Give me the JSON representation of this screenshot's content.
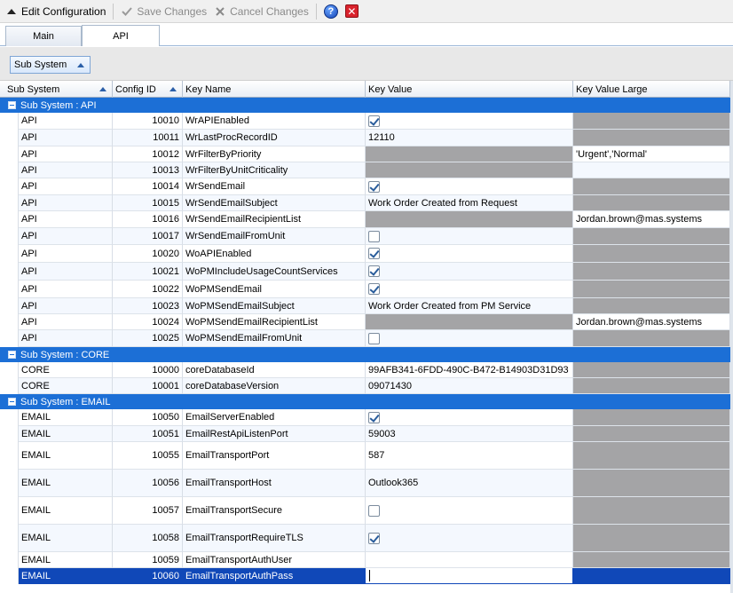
{
  "toolbar": {
    "edit_label": "Edit Configuration",
    "save_label": "Save Changes",
    "cancel_label": "Cancel Changes",
    "help_symbol": "?",
    "close_symbol": "✕"
  },
  "tabs": [
    {
      "label": "Main",
      "active": false
    },
    {
      "label": "API",
      "active": true
    }
  ],
  "group_panel": {
    "chip_label": "Sub System"
  },
  "columns": {
    "sub_system": "Sub System",
    "config_id": "Config ID",
    "key_name": "Key Name",
    "key_value": "Key Value",
    "key_value_large": "Key Value Large"
  },
  "groups": [
    {
      "label": "Sub System : API",
      "rows": [
        {
          "sub": "API",
          "id": "10010",
          "name": "WrAPIEnabled",
          "value_type": "checkbox",
          "checked": true,
          "value": "",
          "large": "",
          "large_gray": true
        },
        {
          "sub": "API",
          "id": "10011",
          "name": "WrLastProcRecordID",
          "value_type": "text",
          "value": "12110",
          "large": "",
          "large_gray": true
        },
        {
          "sub": "API",
          "id": "10012",
          "name": "WrFilterByPriority",
          "value_type": "gray",
          "value": "",
          "large": "'Urgent','Normal'",
          "large_gray": false
        },
        {
          "sub": "API",
          "id": "10013",
          "name": "WrFilterByUnitCriticality",
          "value_type": "gray",
          "value": "",
          "large": "",
          "large_gray": false
        },
        {
          "sub": "API",
          "id": "10014",
          "name": "WrSendEmail",
          "value_type": "checkbox",
          "checked": true,
          "value": "",
          "large": "",
          "large_gray": true
        },
        {
          "sub": "API",
          "id": "10015",
          "name": "WrSendEmailSubject",
          "value_type": "text",
          "value": "Work Order Created from Request",
          "large": "",
          "large_gray": true
        },
        {
          "sub": "API",
          "id": "10016",
          "name": "WrSendEmailRecipientList",
          "value_type": "gray",
          "value": "",
          "large": "Jordan.brown@mas.systems",
          "large_gray": false
        },
        {
          "sub": "API",
          "id": "10017",
          "name": "WrSendEmailFromUnit",
          "value_type": "checkbox",
          "checked": false,
          "value": "",
          "large": "",
          "large_gray": true
        },
        {
          "sub": "API",
          "id": "10020",
          "name": "WoAPIEnabled",
          "value_type": "checkbox",
          "checked": true,
          "value": "",
          "large": "",
          "large_gray": true
        },
        {
          "sub": "API",
          "id": "10021",
          "name": "WoPMIncludeUsageCountServices",
          "value_type": "checkbox",
          "checked": true,
          "value": "",
          "large": "",
          "large_gray": true
        },
        {
          "sub": "API",
          "id": "10022",
          "name": "WoPMSendEmail",
          "value_type": "checkbox",
          "checked": true,
          "value": "",
          "large": "",
          "large_gray": true
        },
        {
          "sub": "API",
          "id": "10023",
          "name": "WoPMSendEmailSubject",
          "value_type": "text",
          "value": "Work Order Created from PM Service",
          "large": "",
          "large_gray": true
        },
        {
          "sub": "API",
          "id": "10024",
          "name": "WoPMSendEmailRecipientList",
          "value_type": "gray",
          "value": "",
          "large": "Jordan.brown@mas.systems",
          "large_gray": false
        },
        {
          "sub": "API",
          "id": "10025",
          "name": "WoPMSendEmailFromUnit",
          "value_type": "checkbox",
          "checked": false,
          "value": "",
          "large": "",
          "large_gray": true
        }
      ]
    },
    {
      "label": "Sub System : CORE",
      "rows": [
        {
          "sub": "CORE",
          "id": "10000",
          "name": "coreDatabaseId",
          "value_type": "text",
          "value": "99AFB341-6FDD-490C-B472-B14903D31D93",
          "large": "",
          "large_gray": true
        },
        {
          "sub": "CORE",
          "id": "10001",
          "name": "coreDatabaseVersion",
          "value_type": "text",
          "value": "09071430",
          "large": "",
          "large_gray": true
        }
      ]
    },
    {
      "label": "Sub System : EMAIL",
      "rows": [
        {
          "sub": "EMAIL",
          "id": "10050",
          "name": "EmailServerEnabled",
          "value_type": "checkbox",
          "checked": true,
          "value": "",
          "large": "",
          "large_gray": true
        },
        {
          "sub": "EMAIL",
          "id": "10051",
          "name": "EmailRestApiListenPort",
          "value_type": "text",
          "value": "59003",
          "large": "",
          "large_gray": true
        },
        {
          "sub": "EMAIL",
          "id": "10055",
          "name": "EmailTransportPort",
          "value_type": "text",
          "value": "587",
          "large": "",
          "large_gray": true
        },
        {
          "sub": "EMAIL",
          "id": "10056",
          "name": "EmailTransportHost",
          "value_type": "text",
          "value": "Outlook365",
          "large": "",
          "large_gray": true
        },
        {
          "sub": "EMAIL",
          "id": "10057",
          "name": "EmailTransportSecure",
          "value_type": "checkbox",
          "checked": false,
          "value": "",
          "large": "",
          "large_gray": true
        },
        {
          "sub": "EMAIL",
          "id": "10058",
          "name": "EmailTransportRequireTLS",
          "value_type": "checkbox",
          "checked": true,
          "value": "",
          "large": "",
          "large_gray": true
        },
        {
          "sub": "EMAIL",
          "id": "10059",
          "name": "EmailTransportAuthUser",
          "value_type": "text",
          "value": "",
          "large": "",
          "large_gray": true
        },
        {
          "sub": "EMAIL",
          "id": "10060",
          "name": "EmailTransportAuthPass",
          "value_type": "editing",
          "value": "",
          "large": "",
          "large_gray": true,
          "selected": true
        }
      ]
    }
  ]
}
